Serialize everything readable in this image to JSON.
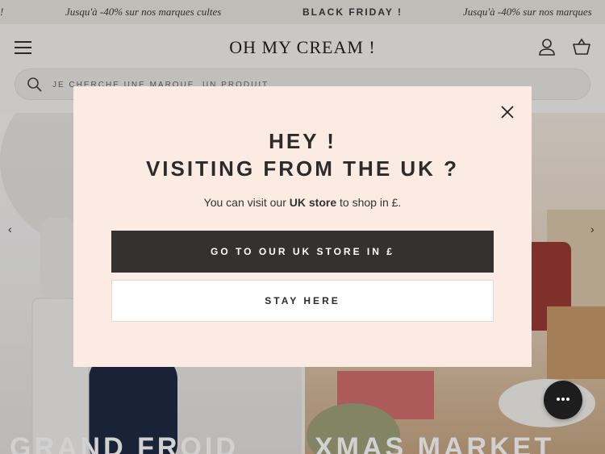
{
  "promo": {
    "left_text": "!",
    "text_1": "Jusqu'à -40% sur nos marques cultes",
    "text_2": "BLACK FRIDAY !",
    "text_3": "Jusqu'à -40% sur nos marques"
  },
  "header": {
    "logo": "OH MY CREAM !",
    "search_placeholder": "JE CHERCHE UNE MARQUE, UN PRODUIT"
  },
  "hero": {
    "left_title": "GRAND FROID",
    "right_title": "XMAS MARKET"
  },
  "modal": {
    "title_line1": "HEY !",
    "title_line2": "VISITING FROM THE UK ?",
    "text_before": "You can visit our ",
    "text_bold": "UK store",
    "text_after": " to shop in £.",
    "primary_button": "GO TO OUR UK STORE IN £",
    "secondary_button": "STAY HERE"
  },
  "colors": {
    "modal_bg": "#fcebe3",
    "primary_button_bg": "#333231",
    "page_bg": "#f6f5f3"
  },
  "icons": [
    "menu-icon",
    "user-icon",
    "bag-icon",
    "search-icon",
    "close-icon",
    "chat-icon",
    "chevron-left-icon",
    "chevron-right-icon"
  ]
}
